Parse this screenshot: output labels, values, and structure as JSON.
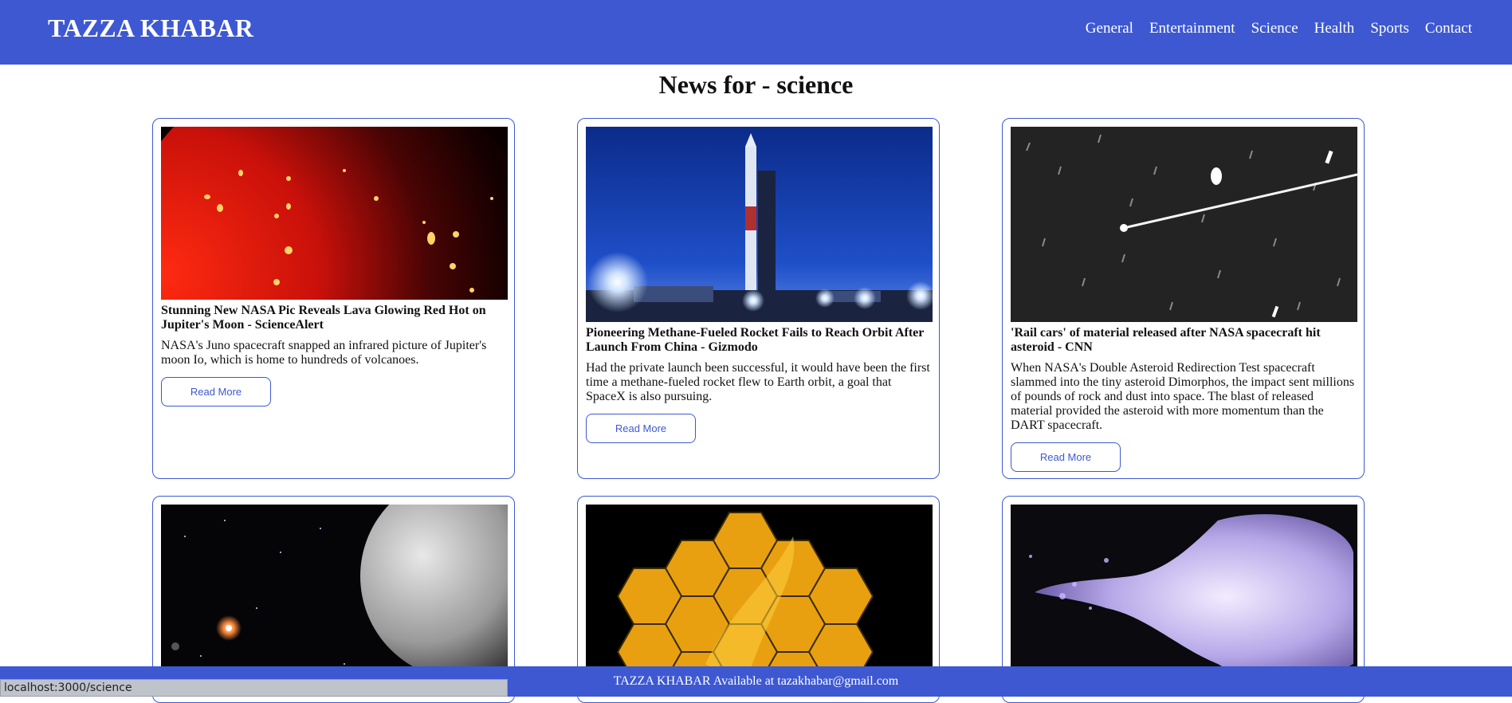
{
  "nav": {
    "brand": "TAZZA KHABAR",
    "links": [
      "General",
      "Entertainment",
      "Science",
      "Health",
      "Sports",
      "Contact"
    ]
  },
  "page": {
    "title": "News for - science"
  },
  "articles": [
    {
      "title": "Stunning New NASA Pic Reveals Lava Glowing Red Hot on Jupiter's Moon - ScienceAlert",
      "description": "NASA's Juno spacecraft snapped an infrared picture of Jupiter's moon Io, which is home to hundreds of volcanoes.",
      "button": "Read More"
    },
    {
      "title": "Pioneering Methane-Fueled Rocket Fails to Reach Orbit After Launch From China - Gizmodo",
      "description": "Had the private launch been successful, it would have been the first time a methane-fueled rocket flew to Earth orbit, a goal that SpaceX is also pursuing.",
      "button": "Read More"
    },
    {
      "title": "'Rail cars' of material released after NASA spacecraft hit asteroid - CNN",
      "description": "When NASA's Double Asteroid Redirection Test spacecraft slammed into the tiny asteroid Dimorphos, the impact sent millions of pounds of rock and dust into space. The blast of released material provided the asteroid with more momentum than the DART spacecraft.",
      "button": "Read More"
    }
  ],
  "footer": {
    "text": "TAZZA KHABAR Available at tazakhabar@gmail.com"
  },
  "statusbar": {
    "url": "localhost:3000/science"
  },
  "colors": {
    "primary": "#3d58d1",
    "background": "#ffffff"
  }
}
